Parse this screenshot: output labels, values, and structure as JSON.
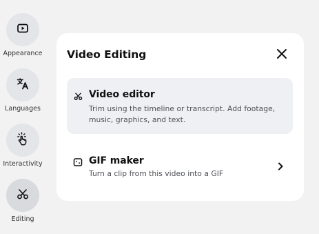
{
  "sidebar": {
    "items": [
      {
        "label": "Appearance",
        "icon": "play-square-icon"
      },
      {
        "label": "Languages",
        "icon": "translate-icon"
      },
      {
        "label": "Interactivity",
        "icon": "tap-hand-icon"
      },
      {
        "label": "Editing",
        "icon": "scissors-icon",
        "active": true
      }
    ]
  },
  "panel": {
    "title": "Video Editing",
    "close_icon": "close-icon",
    "options": [
      {
        "title": "Video editor",
        "description": "Trim using the timeline or transcript. Add footage, music, graphics, and text.",
        "icon": "scissors-icon",
        "selected": true
      },
      {
        "title": "GIF maker",
        "description": "Turn a clip from this video into a GIF",
        "icon": "gif-icon",
        "chevron": "chevron-right-icon"
      }
    ]
  },
  "colors": {
    "background": "#f2f2f3",
    "panel": "#ffffff",
    "selected_option": "#eef0f4",
    "rail_circle": "#e4e5e8"
  }
}
